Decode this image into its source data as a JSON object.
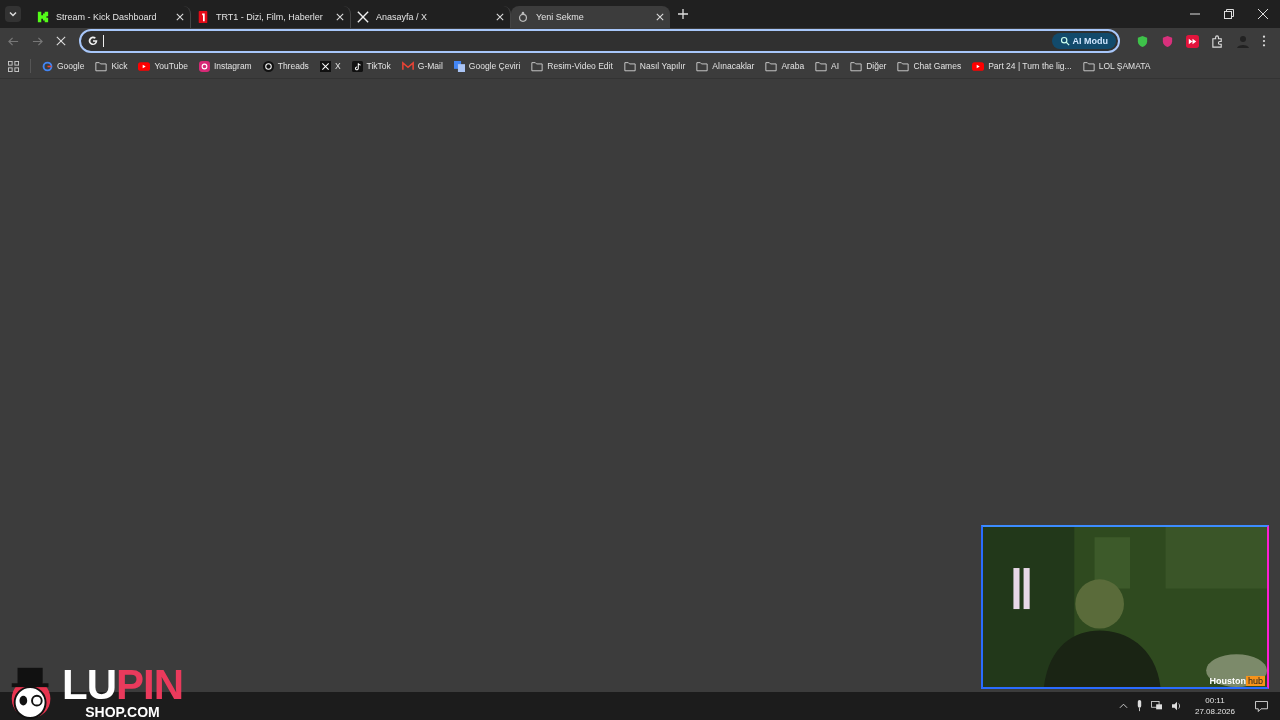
{
  "tabs": [
    {
      "title": "Stream - Kick Dashboard",
      "kind": "kick",
      "selected": false
    },
    {
      "title": "TRT1 - Dizi, Film, Haberler",
      "kind": "trt",
      "selected": false
    },
    {
      "title": "Anasayfa / X",
      "kind": "x",
      "selected": false
    },
    {
      "title": "Yeni Sekme",
      "kind": "loading",
      "selected": true
    }
  ],
  "omnibox": {
    "ai_button": "AI Modu"
  },
  "bookmarks": [
    {
      "label": "Google",
      "kind": "google"
    },
    {
      "label": "Kick",
      "kind": "folder"
    },
    {
      "label": "YouTube",
      "kind": "youtube"
    },
    {
      "label": "Instagram",
      "kind": "instagram"
    },
    {
      "label": "Threads",
      "kind": "threads"
    },
    {
      "label": "X",
      "kind": "x"
    },
    {
      "label": "TikTok",
      "kind": "tiktok"
    },
    {
      "label": "G-Mail",
      "kind": "gmail"
    },
    {
      "label": "Google Çeviri",
      "kind": "translate"
    },
    {
      "label": "Resim-Video Edit",
      "kind": "folder"
    },
    {
      "label": "Nasıl Yapılır",
      "kind": "folder"
    },
    {
      "label": "Alınacaklar",
      "kind": "folder"
    },
    {
      "label": "Araba",
      "kind": "folder"
    },
    {
      "label": "AI",
      "kind": "folder"
    },
    {
      "label": "Diğer",
      "kind": "folder"
    },
    {
      "label": "Chat Games",
      "kind": "folder"
    },
    {
      "label": "Part 24 | Turn the lig...",
      "kind": "youtube"
    },
    {
      "label": "LOL ŞAMATA",
      "kind": "folder"
    }
  ],
  "overlay": {
    "logo_left": "LU",
    "logo_right": "PIN",
    "logo_sub": "SHOP.COM",
    "webcam_label": "Houston",
    "webcam_tag": "hub"
  },
  "taskbar": {
    "time": "00:11",
    "date": "27.08.2026"
  }
}
